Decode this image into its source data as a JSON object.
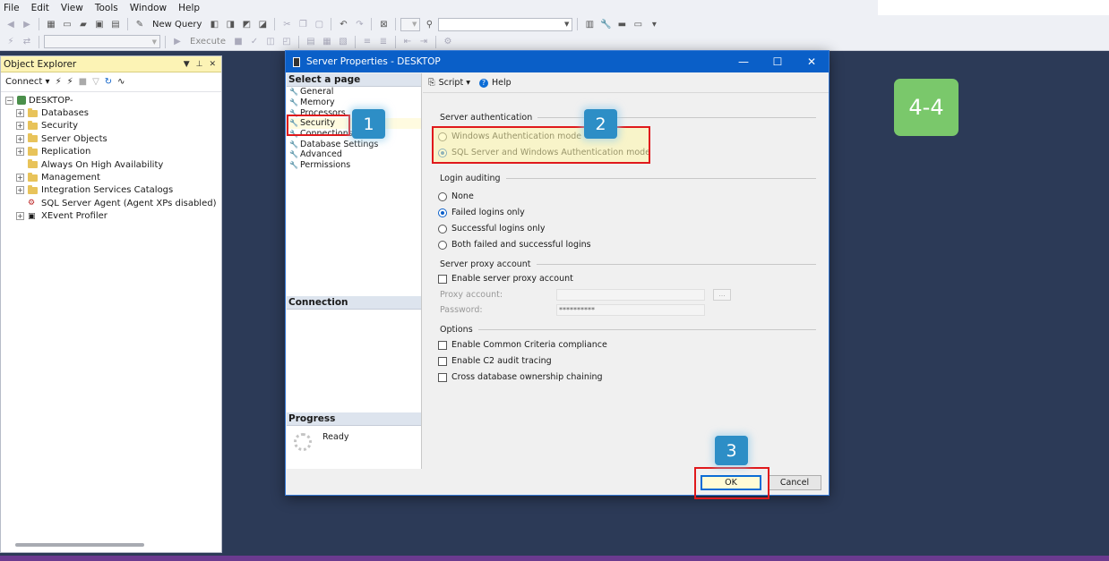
{
  "menu": [
    "File",
    "Edit",
    "View",
    "Tools",
    "Window",
    "Help"
  ],
  "toolbar": {
    "new_query": "New Query",
    "execute": "Execute",
    "query_buttons": [
      "MDX",
      "DMX",
      "XMLA",
      "DAX"
    ]
  },
  "object_explorer": {
    "title": "Object Explorer",
    "connect_label": "Connect",
    "server": "DESKTOP-",
    "nodes": [
      {
        "label": "Databases",
        "type": "folder",
        "expandable": true
      },
      {
        "label": "Security",
        "type": "folder",
        "expandable": true
      },
      {
        "label": "Server Objects",
        "type": "folder",
        "expandable": true
      },
      {
        "label": "Replication",
        "type": "folder",
        "expandable": true
      },
      {
        "label": "Always On High Availability",
        "type": "folder",
        "expandable": false
      },
      {
        "label": "Management",
        "type": "folder",
        "expandable": true
      },
      {
        "label": "Integration Services Catalogs",
        "type": "folder",
        "expandable": true
      },
      {
        "label": "SQL Server Agent (Agent XPs disabled)",
        "type": "agent",
        "expandable": false
      },
      {
        "label": "XEvent Profiler",
        "type": "profiler",
        "expandable": true
      }
    ]
  },
  "dialog": {
    "title": "Server Properties - DESKTOP",
    "select_page_header": "Select a page",
    "pages": [
      "General",
      "Memory",
      "Processors",
      "Security",
      "Connections",
      "Database Settings",
      "Advanced",
      "Permissions"
    ],
    "selected_page": "Security",
    "connection_header": "Connection",
    "progress_header": "Progress",
    "progress_status": "Ready",
    "script_label": "Script",
    "help_label": "Help",
    "server_auth": {
      "title": "Server authentication",
      "options": [
        "Windows Authentication mode",
        "SQL Server and Windows Authentication mode"
      ],
      "selected": 1
    },
    "login_auditing": {
      "title": "Login auditing",
      "options": [
        "None",
        "Failed logins only",
        "Successful logins only",
        "Both failed and successful logins"
      ],
      "selected": 1
    },
    "proxy": {
      "title": "Server proxy account",
      "enable_label": "Enable server proxy account",
      "enabled": false,
      "account_label": "Proxy account:",
      "password_label": "Password:",
      "password_value": "**********",
      "browse_label": "..."
    },
    "options": {
      "title": "Options",
      "items": [
        "Enable Common Criteria compliance",
        "Enable C2 audit tracing",
        "Cross database ownership chaining"
      ]
    },
    "ok_label": "OK",
    "cancel_label": "Cancel"
  },
  "annotations": {
    "step_labels": [
      "1",
      "2",
      "3"
    ],
    "step_badge": "4-4",
    "badge_color": "#2d8ec6",
    "highlight_color": "#e0191c",
    "step_badge_color": "#7ac86b"
  }
}
